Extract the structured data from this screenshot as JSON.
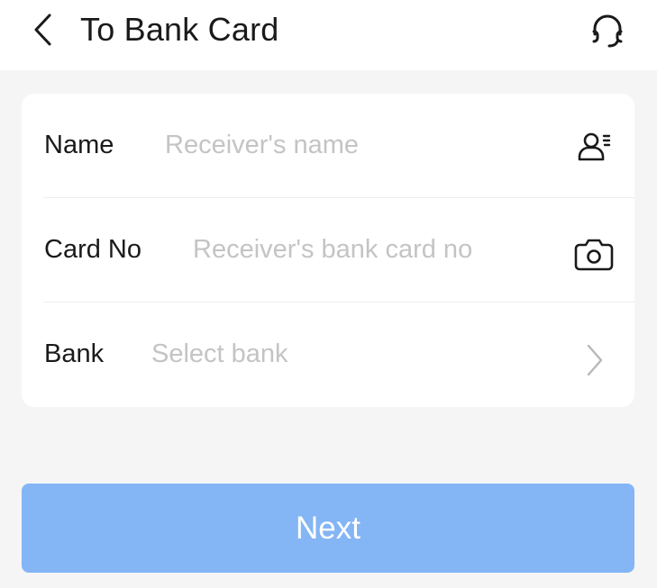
{
  "header": {
    "title": "To Bank Card",
    "back_icon": "chevron-left-icon",
    "support_icon": "headset-icon"
  },
  "form": {
    "rows": [
      {
        "label": "Name",
        "placeholder": "Receiver's name",
        "value": "",
        "icon": "contacts-icon"
      },
      {
        "label": "Card No",
        "placeholder": "Receiver's bank card no",
        "value": "",
        "icon": "camera-icon"
      },
      {
        "label": "Bank",
        "placeholder": "Select bank",
        "value": "",
        "icon": "chevron-right-icon"
      }
    ]
  },
  "next_button": {
    "label": "Next",
    "enabled": false
  },
  "colors": {
    "background": "#f5f5f5",
    "card": "#ffffff",
    "text_primary": "#1a1a1a",
    "placeholder": "#c4c4c4",
    "button_disabled": "#84b5f5",
    "button_text": "#ffffff"
  }
}
